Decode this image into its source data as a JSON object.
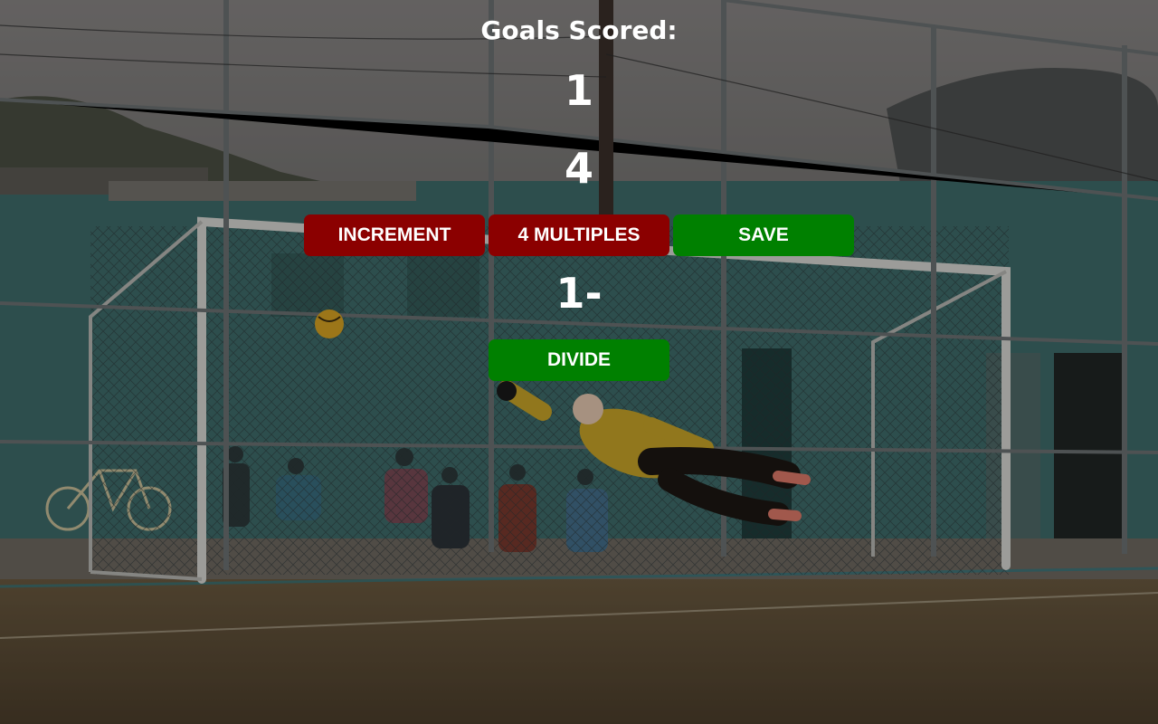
{
  "heading": "Goals Scored:",
  "count_value": "1",
  "multiple_value": "4",
  "saved_entries": "1-",
  "buttons": {
    "increment": "INCREMENT",
    "multiples": "4 MULTIPLES",
    "save": "SAVE",
    "divide": "DIVIDE"
  },
  "colors": {
    "red_button": "#8b0000",
    "green_button": "#008000",
    "text": "#ffffff"
  },
  "background": "soccer-goalkeeper-diving-save-photo"
}
